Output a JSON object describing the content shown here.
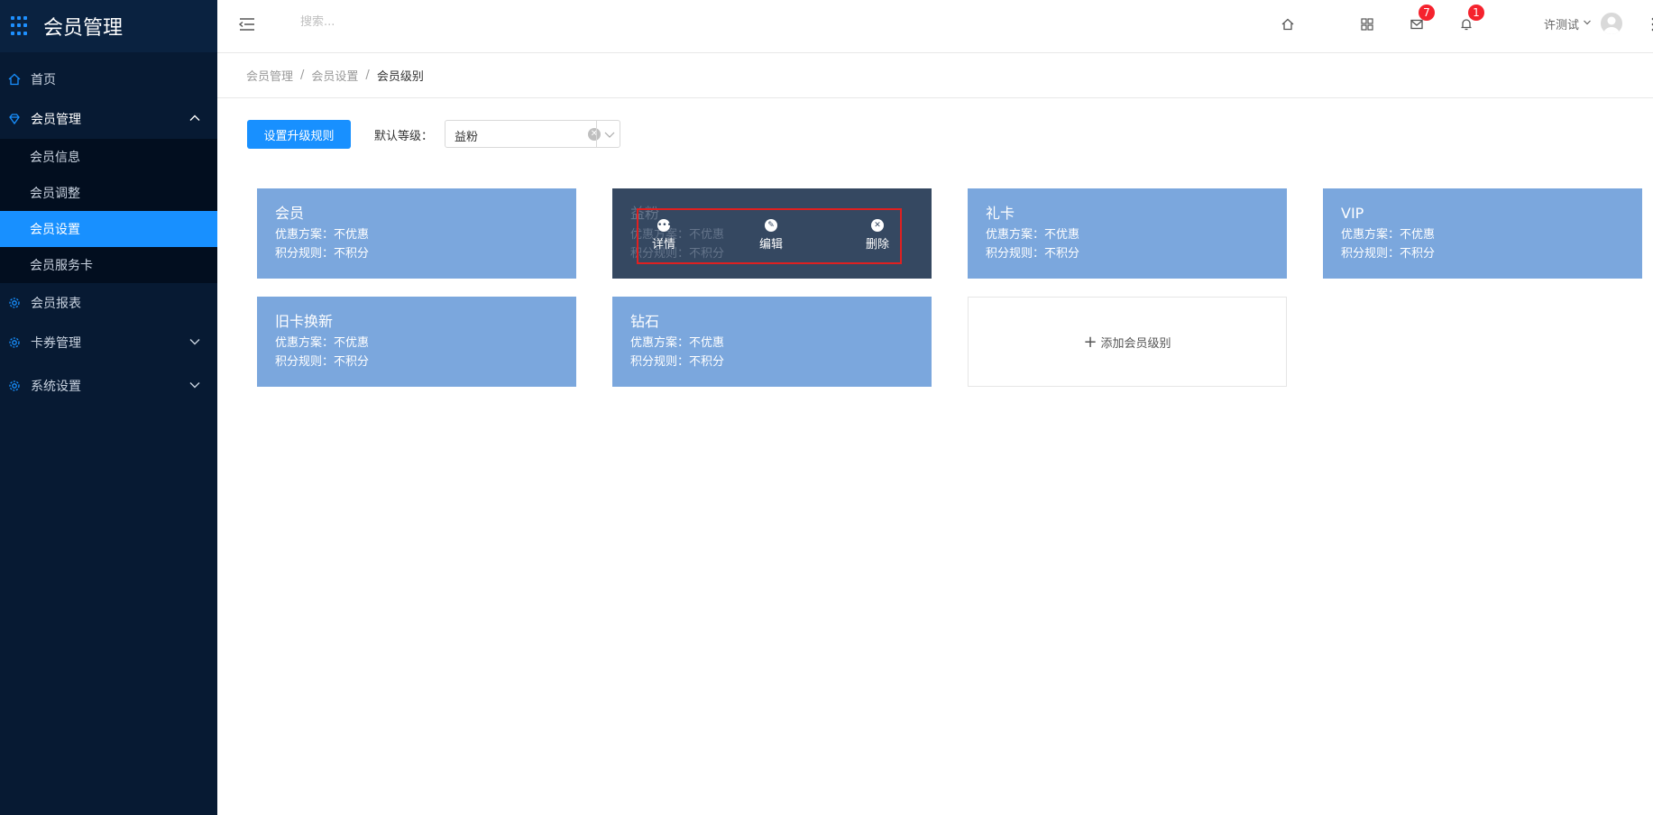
{
  "app": {
    "title": "会员管理"
  },
  "sidebar": {
    "items": [
      {
        "label": "首页"
      },
      {
        "label": "会员管理"
      },
      {
        "label": "会员报表"
      },
      {
        "label": "卡券管理"
      },
      {
        "label": "系统设置"
      }
    ],
    "subitems": [
      {
        "label": "会员信息"
      },
      {
        "label": "会员调整"
      },
      {
        "label": "会员设置"
      },
      {
        "label": "会员服务卡"
      }
    ]
  },
  "header": {
    "search_placeholder": "搜索...",
    "mail_badge": "7",
    "bell_badge": "1",
    "user_name": "许测试"
  },
  "breadcrumb": {
    "items": [
      "会员管理",
      "会员设置"
    ],
    "current": "会员级别"
  },
  "toolbar": {
    "upgrade_button": "设置升级规则",
    "default_level_label": "默认等级：",
    "default_level_value": "益粉"
  },
  "levels": [
    {
      "name": "会员",
      "discount": "优惠方案：不优惠",
      "points": "积分规则：不积分"
    },
    {
      "name": "益粉",
      "discount": "优惠方案：不优惠",
      "points": "积分规则：不积分"
    },
    {
      "name": "礼卡",
      "discount": "优惠方案：不优惠",
      "points": "积分规则：不积分"
    },
    {
      "name": "VIP",
      "discount": "优惠方案：不优惠",
      "points": "积分规则：不积分"
    },
    {
      "name": "旧卡换新",
      "discount": "优惠方案：不优惠",
      "points": "积分规则：不积分"
    },
    {
      "name": "钻石",
      "discount": "优惠方案：不优惠",
      "points": "积分规则：不积分"
    }
  ],
  "hover_actions": {
    "detail": "详情",
    "edit": "编辑",
    "delete": "删除"
  },
  "add_card": {
    "label": "添加会员级别"
  },
  "colors": {
    "sidebar_bg": "#071a33",
    "accent": "#1890ff",
    "card_bg": "#7ba7dd",
    "card_hover_bg": "#354861",
    "badge": "#f5222d",
    "highlight_border": "#e02020"
  }
}
